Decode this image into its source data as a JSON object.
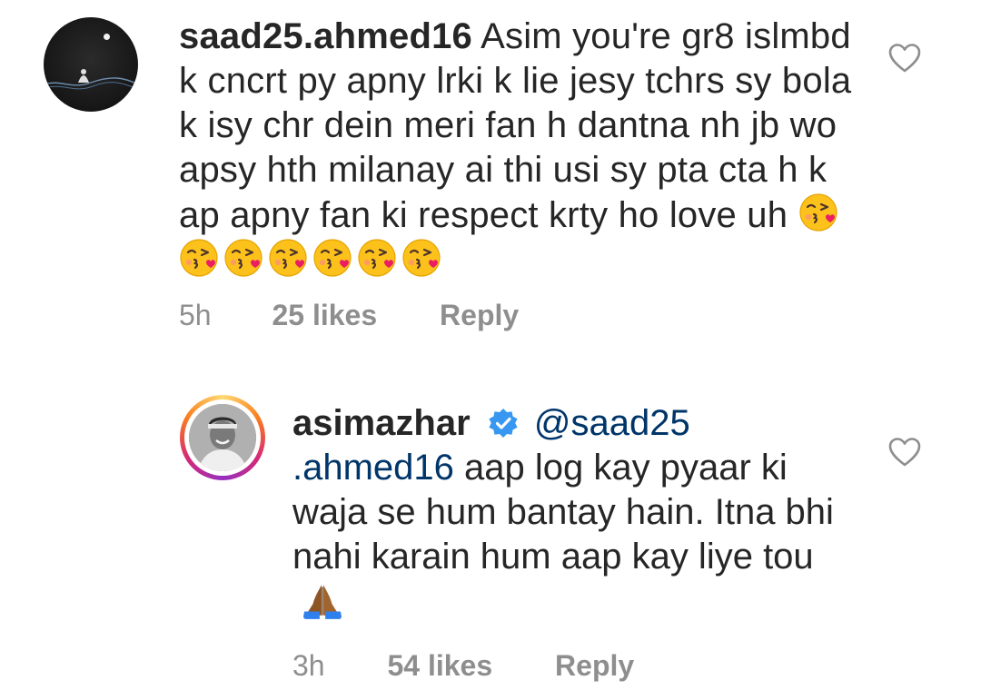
{
  "comment": {
    "username": "saad25.ahmed16",
    "text": "Asim you're gr8 islmbd k cncrt py apny lrki k lie jesy tchrs sy bola k isy chr dein meri fan h dantna nh jb wo apsy hth milanay ai thi usi sy pta cta h k ap apny fan ki respect krty ho love uh",
    "emoji": "face-throwing-kiss",
    "emoji_count": 7,
    "time": "5h",
    "likes": "25 likes",
    "reply_label": "Reply"
  },
  "reply": {
    "username": "asimazhar",
    "verified": true,
    "mention": "@saad25 .ahmed16",
    "text": "aap log kay pyaar ki waja se hum bantay hain. Itna bhi nahi karain hum aap kay liye tou",
    "emoji": "folded-hands",
    "time": "3h",
    "likes": "54 likes",
    "reply_label": "Reply"
  },
  "colors": {
    "text": "#262626",
    "meta": "#8e8e8e",
    "mention": "#003569",
    "verified": "#3897f0"
  }
}
